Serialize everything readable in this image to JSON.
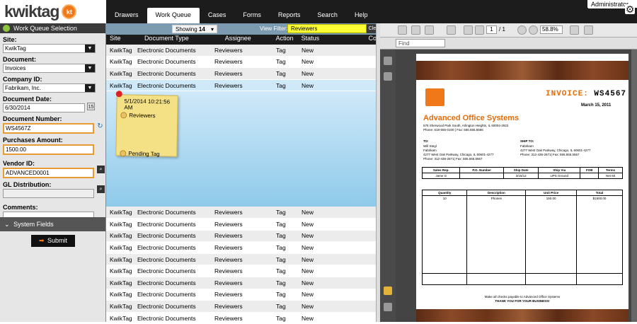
{
  "app": {
    "logo_text": "kwiktag",
    "logo_badge": "kt",
    "user": "Administrator"
  },
  "nav": [
    "Drawers",
    "Work Queue",
    "Cases",
    "Forms",
    "Reports",
    "Search",
    "Help"
  ],
  "left": {
    "header": "Work Queue Selection",
    "fields": {
      "site_label": "Site:",
      "site": "KwikTag",
      "document_label": "Document:",
      "document": "Invoices",
      "company_label": "Company ID:",
      "company": "Fabrikam, Inc.",
      "date_label": "Document Date:",
      "date": "6/30/2014",
      "number_label": "Document Number:",
      "number": "WS4567Z",
      "amount_label": "Purchases Amount:",
      "amount": "1500.00",
      "vendor_label": "Vendor ID:",
      "vendor": "ADVANCED0001",
      "gl_label": "GL Distribution:",
      "gl": "",
      "comments_label": "Comments:",
      "comments": ""
    },
    "system_fields": "System Fields",
    "submit": "Submit"
  },
  "queue": {
    "showing_label": "Showing",
    "showing_value": "14",
    "view_filter_label": "View Filter:",
    "view_filter": "Reviewers",
    "clear": "Clear",
    "columns": [
      "Site",
      "Document Type",
      "Assignee",
      "Action",
      "Status",
      "Con"
    ],
    "rows_top": [
      [
        "KwikTag",
        "Electronic Documents",
        "Reviewers",
        "Tag",
        "New"
      ],
      [
        "KwikTag",
        "Electronic Documents",
        "Reviewers",
        "Tag",
        "New"
      ],
      [
        "KwikTag",
        "Electronic Documents",
        "Reviewers",
        "Tag",
        "New"
      ],
      [
        "KwikTag",
        "Electronic Documents",
        "Reviewers",
        "Tag",
        "New"
      ]
    ],
    "note": {
      "time": "5/1/2014 10:21:56 AM",
      "user": "Reviewers",
      "tag": "Pending Tag"
    },
    "rows_bottom": [
      [
        "KwikTag",
        "Electronic Documents",
        "Reviewers",
        "Tag",
        "New"
      ],
      [
        "KwikTag",
        "Electronic Documents",
        "Reviewers",
        "Tag",
        "New"
      ],
      [
        "KwikTag",
        "Electronic Documents",
        "Reviewers",
        "Tag",
        "New"
      ],
      [
        "KwikTag",
        "Electronic Documents",
        "Reviewers",
        "Tag",
        "New"
      ],
      [
        "KwikTag",
        "Electronic Documents",
        "Reviewers",
        "Tag",
        "New"
      ],
      [
        "KwikTag",
        "Electronic Documents",
        "Reviewers",
        "Tag",
        "New"
      ],
      [
        "KwikTag",
        "Electronic Documents",
        "Reviewers",
        "Tag",
        "New"
      ],
      [
        "KwikTag",
        "Electronic Documents",
        "Reviewers",
        "Tag",
        "New"
      ],
      [
        "KwikTag",
        "Electronic Documents",
        "Reviewers",
        "Tag",
        "New"
      ],
      [
        "KwikTag",
        "Electronic Documents",
        "Reviewers",
        "Tag",
        "New"
      ]
    ]
  },
  "viewer": {
    "page": "1",
    "page_of": "/ 1",
    "zoom": "58.8%",
    "find_placeholder": "Find",
    "invoice": {
      "title_prefix": "INVOICE:",
      "title_number": "WS4567",
      "date": "March 15, 2011",
      "company": "Advanced Office Systems",
      "company_addr1": "678 Sherwood Park South, Arlington Heights, IL 60004-2922",
      "company_addr2": "Phone: 618-555-0100  |  Fax: 555.555.5555",
      "to_label": "TO:",
      "to1": "Will Stegl",
      "to2": "Fabrikam",
      "to3": "4277 West Oak Parkway, Chicago, IL 60601-4277",
      "to4": "Phone: 312-436-2671|  Fax: 555.555.5567",
      "ship_label": "SHIP TO:",
      "ship1": "Fabrikam",
      "ship2": "4277 West Oak Parkway, Chicago, IL 60601-4277",
      "ship3": "Phone: 312-436-2671|  Fax: 555.555.5567",
      "sales_headers": [
        "Sales Rep.",
        "P.O. Number",
        "Ship Date",
        "Ship Via",
        "FOB",
        "Terms"
      ],
      "sales_values": [
        "Jame G",
        "",
        "3/15/12",
        "UPS Ground",
        "",
        "Net 60"
      ],
      "item_headers": [
        "Quantity",
        "Description",
        "Unit Price",
        "Total"
      ],
      "item_values": [
        "10",
        "Phones",
        "150.00",
        "$1500.00"
      ],
      "footer1": "Make all checks payable to Advanced Office Systems",
      "footer2": "THANK YOU FOR YOUR BUSINESS!"
    }
  }
}
